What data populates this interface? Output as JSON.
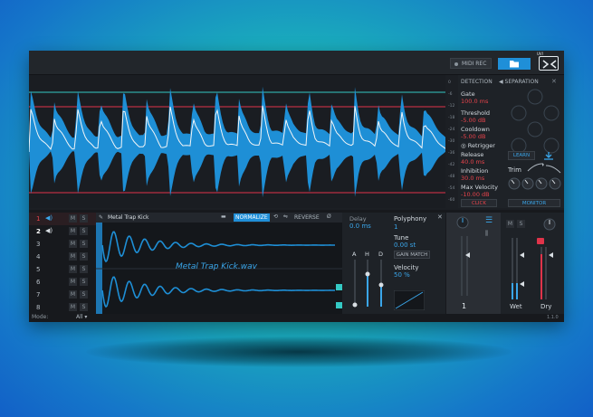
{
  "topbar": {
    "midi_rec": "MIDI REC"
  },
  "detection": {
    "tab_detection": "DETECTION",
    "tab_separation": "SEPARATION",
    "gate_label": "Gate",
    "gate_value": "100.0 ms",
    "threshold_label": "Threshold",
    "threshold_value": "-5.00 dB",
    "cooldown_label": "Cooldown",
    "cooldown_value": "-5.00 dB",
    "retrigger_label": "Retrigger",
    "release_label": "Release",
    "release_value": "40.0 ms",
    "inhibition_label": "Inhibition",
    "inhibition_value": "30.0 ms",
    "max_velocity_label": "Max Velocity",
    "max_velocity_value": "-10.00 dB",
    "click_label": "CLICK",
    "learn_label": "LEARN",
    "trim_label": "Trim",
    "monitor_label": "MONITOR",
    "db_scale": [
      "0",
      "-6",
      "-12",
      "-18",
      "-24",
      "-30",
      "-36",
      "-42",
      "-48",
      "-54",
      "-60"
    ]
  },
  "sampler": {
    "rows": [
      {
        "num": "1"
      },
      {
        "num": "2"
      },
      {
        "num": "3"
      },
      {
        "num": "4"
      },
      {
        "num": "5"
      },
      {
        "num": "6"
      },
      {
        "num": "7"
      },
      {
        "num": "8"
      }
    ],
    "m_label": "M",
    "s_label": "S",
    "mode_label": "Mode:",
    "mode_value": "All",
    "sample_name": "Metal Trap Kick",
    "file_name": "Metal Trap Kick.wav",
    "normalize": "NORMALIZE",
    "reverse": "REVERSE",
    "delay_label": "Delay",
    "delay_value": "0.0 ms",
    "polyphony_label": "Polyphony",
    "polyphony_value": "1",
    "tune_label": "Tune",
    "tune_value": "0.00 st",
    "gain_match": "GAIN MATCH",
    "velocity_label": "Velocity",
    "velocity_value": "50 %",
    "adsr_a": "A",
    "adsr_h": "H",
    "adsr_d": "D",
    "output_number": "1",
    "wet_label": "Wet",
    "dry_label": "Dry",
    "version": "1.1.0"
  },
  "colors": {
    "accent": "#1f8fd8",
    "value_red": "#e8434b",
    "waveform": "#1e8fd6"
  }
}
